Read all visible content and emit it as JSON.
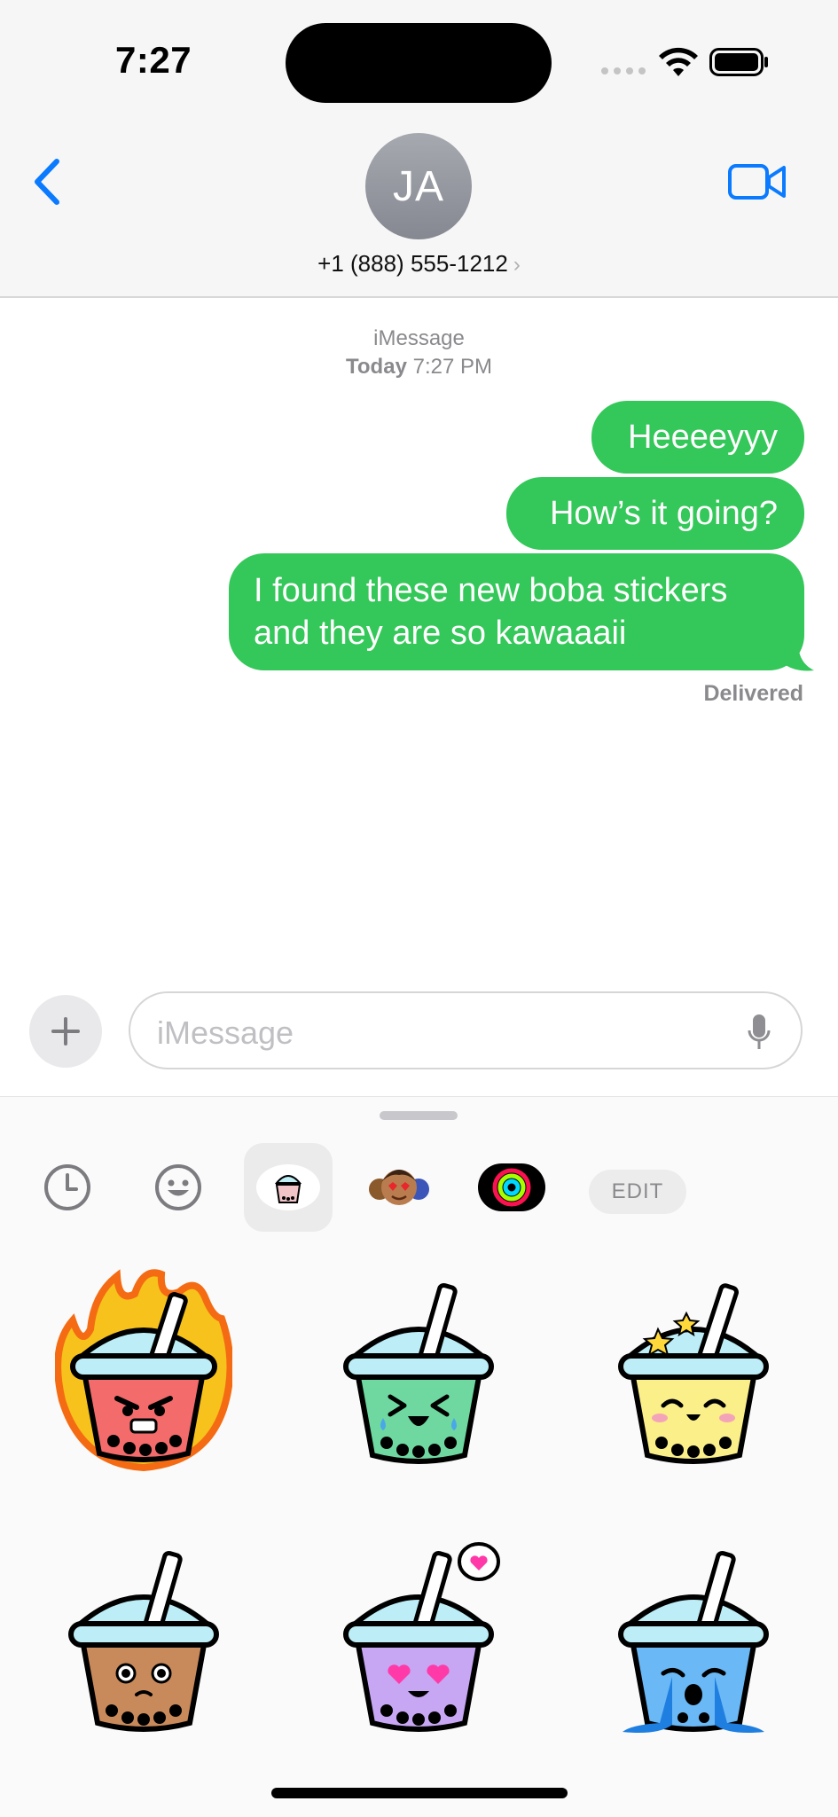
{
  "status_bar": {
    "time": "7:27"
  },
  "header": {
    "avatar_initials": "JA",
    "contact": "+1 (888) 555-1212",
    "contact_chevron": "›"
  },
  "conversation": {
    "service": "iMessage",
    "date_label": "Today",
    "time": "7:27 PM",
    "messages": [
      {
        "text": "Heeeeyyy",
        "direction": "outgoing"
      },
      {
        "text": "How’s it going?",
        "direction": "outgoing"
      },
      {
        "text": "I found these new boba stickers and they are so kawaaaii",
        "direction": "outgoing"
      }
    ],
    "status": "Delivered"
  },
  "composer": {
    "placeholder": "iMessage"
  },
  "drawer": {
    "tabs": [
      "recents-icon",
      "emoji-icon",
      "boba-sticker-pack-icon",
      "memoji-icon",
      "activity-rings-icon"
    ],
    "selected_tab": "boba-sticker-pack-icon",
    "edit_label": "EDIT",
    "stickers": [
      {
        "name": "angry-fire-boba"
      },
      {
        "name": "laughing-crying-green-boba"
      },
      {
        "name": "starry-happy-yellow-boba"
      },
      {
        "name": "worried-brown-boba"
      },
      {
        "name": "heart-eyes-purple-boba"
      },
      {
        "name": "sobbing-blue-boba"
      }
    ]
  },
  "colors": {
    "accent": "#0a7aff",
    "bubble_outgoing": "#34c759",
    "meta_text": "#8a8a8e"
  }
}
